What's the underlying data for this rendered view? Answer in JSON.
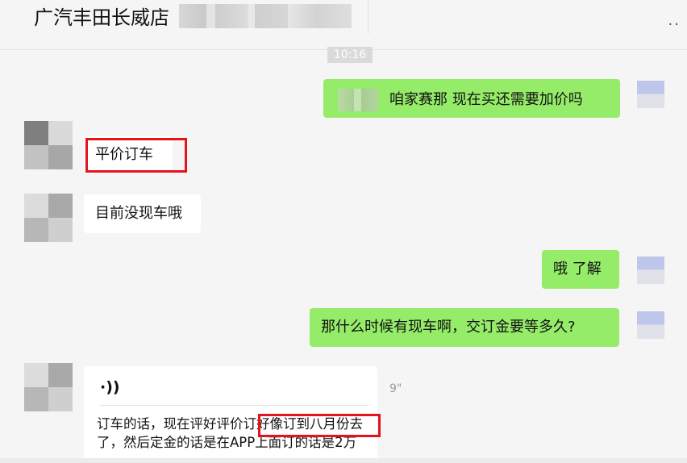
{
  "header": {
    "title": "广汽丰田长威店",
    "more_icon": "more-dots-icon"
  },
  "chat": {
    "timestamp": "10:16",
    "messages": [
      {
        "side": "right",
        "text": "咱家赛那  现在买还需要加价吗"
      },
      {
        "side": "left",
        "text": "平价订车"
      },
      {
        "side": "left",
        "text": "目前没现车哦"
      },
      {
        "side": "right",
        "text": "哦 了解"
      },
      {
        "side": "right",
        "text": "那什么时候有现车啊，交订金要等多久?"
      }
    ],
    "voice": {
      "icon": "voice-wave-icon",
      "icon_glyph": "·))",
      "duration": "9\"",
      "transcript_line1": "订车的话，现在评好评价订好像订到八月份去",
      "transcript_line2": "了，然后定金的话是在APP上面订的话是2万"
    }
  },
  "colors": {
    "background": "#f5f5f5",
    "self_bubble": "#95ec69",
    "other_bubble": "#ffffff",
    "highlight_box": "#e5131a"
  }
}
